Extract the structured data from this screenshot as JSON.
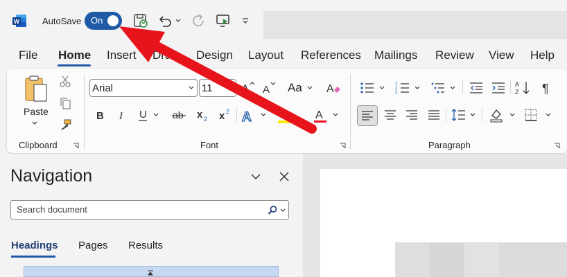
{
  "titlebar": {
    "app_icon": "word-app-icon",
    "autosave_label": "AutoSave",
    "autosave_state": "On",
    "quick_access": [
      "save-sync-icon",
      "undo-icon",
      "redo-icon",
      "present-icon",
      "customize-icon"
    ]
  },
  "menu": {
    "tabs": [
      "File",
      "Home",
      "Insert",
      "Draw",
      "Design",
      "Layout",
      "References",
      "Mailings",
      "Review",
      "View",
      "Help"
    ],
    "active": "Home"
  },
  "ribbon": {
    "clipboard": {
      "paste_label": "Paste",
      "group_label": "Clipboard"
    },
    "font": {
      "font_name": "Arial",
      "font_size": "11",
      "group_label": "Font",
      "change_case": "Aa"
    },
    "paragraph": {
      "group_label": "Paragraph"
    }
  },
  "navigation": {
    "title": "Navigation",
    "search_placeholder": "Search document",
    "tabs": [
      "Headings",
      "Pages",
      "Results"
    ]
  },
  "colors": {
    "accent": "#1f5aa6",
    "arrow": "#e8141b",
    "highlight": "#ffea00",
    "font_color": "#e81123"
  }
}
